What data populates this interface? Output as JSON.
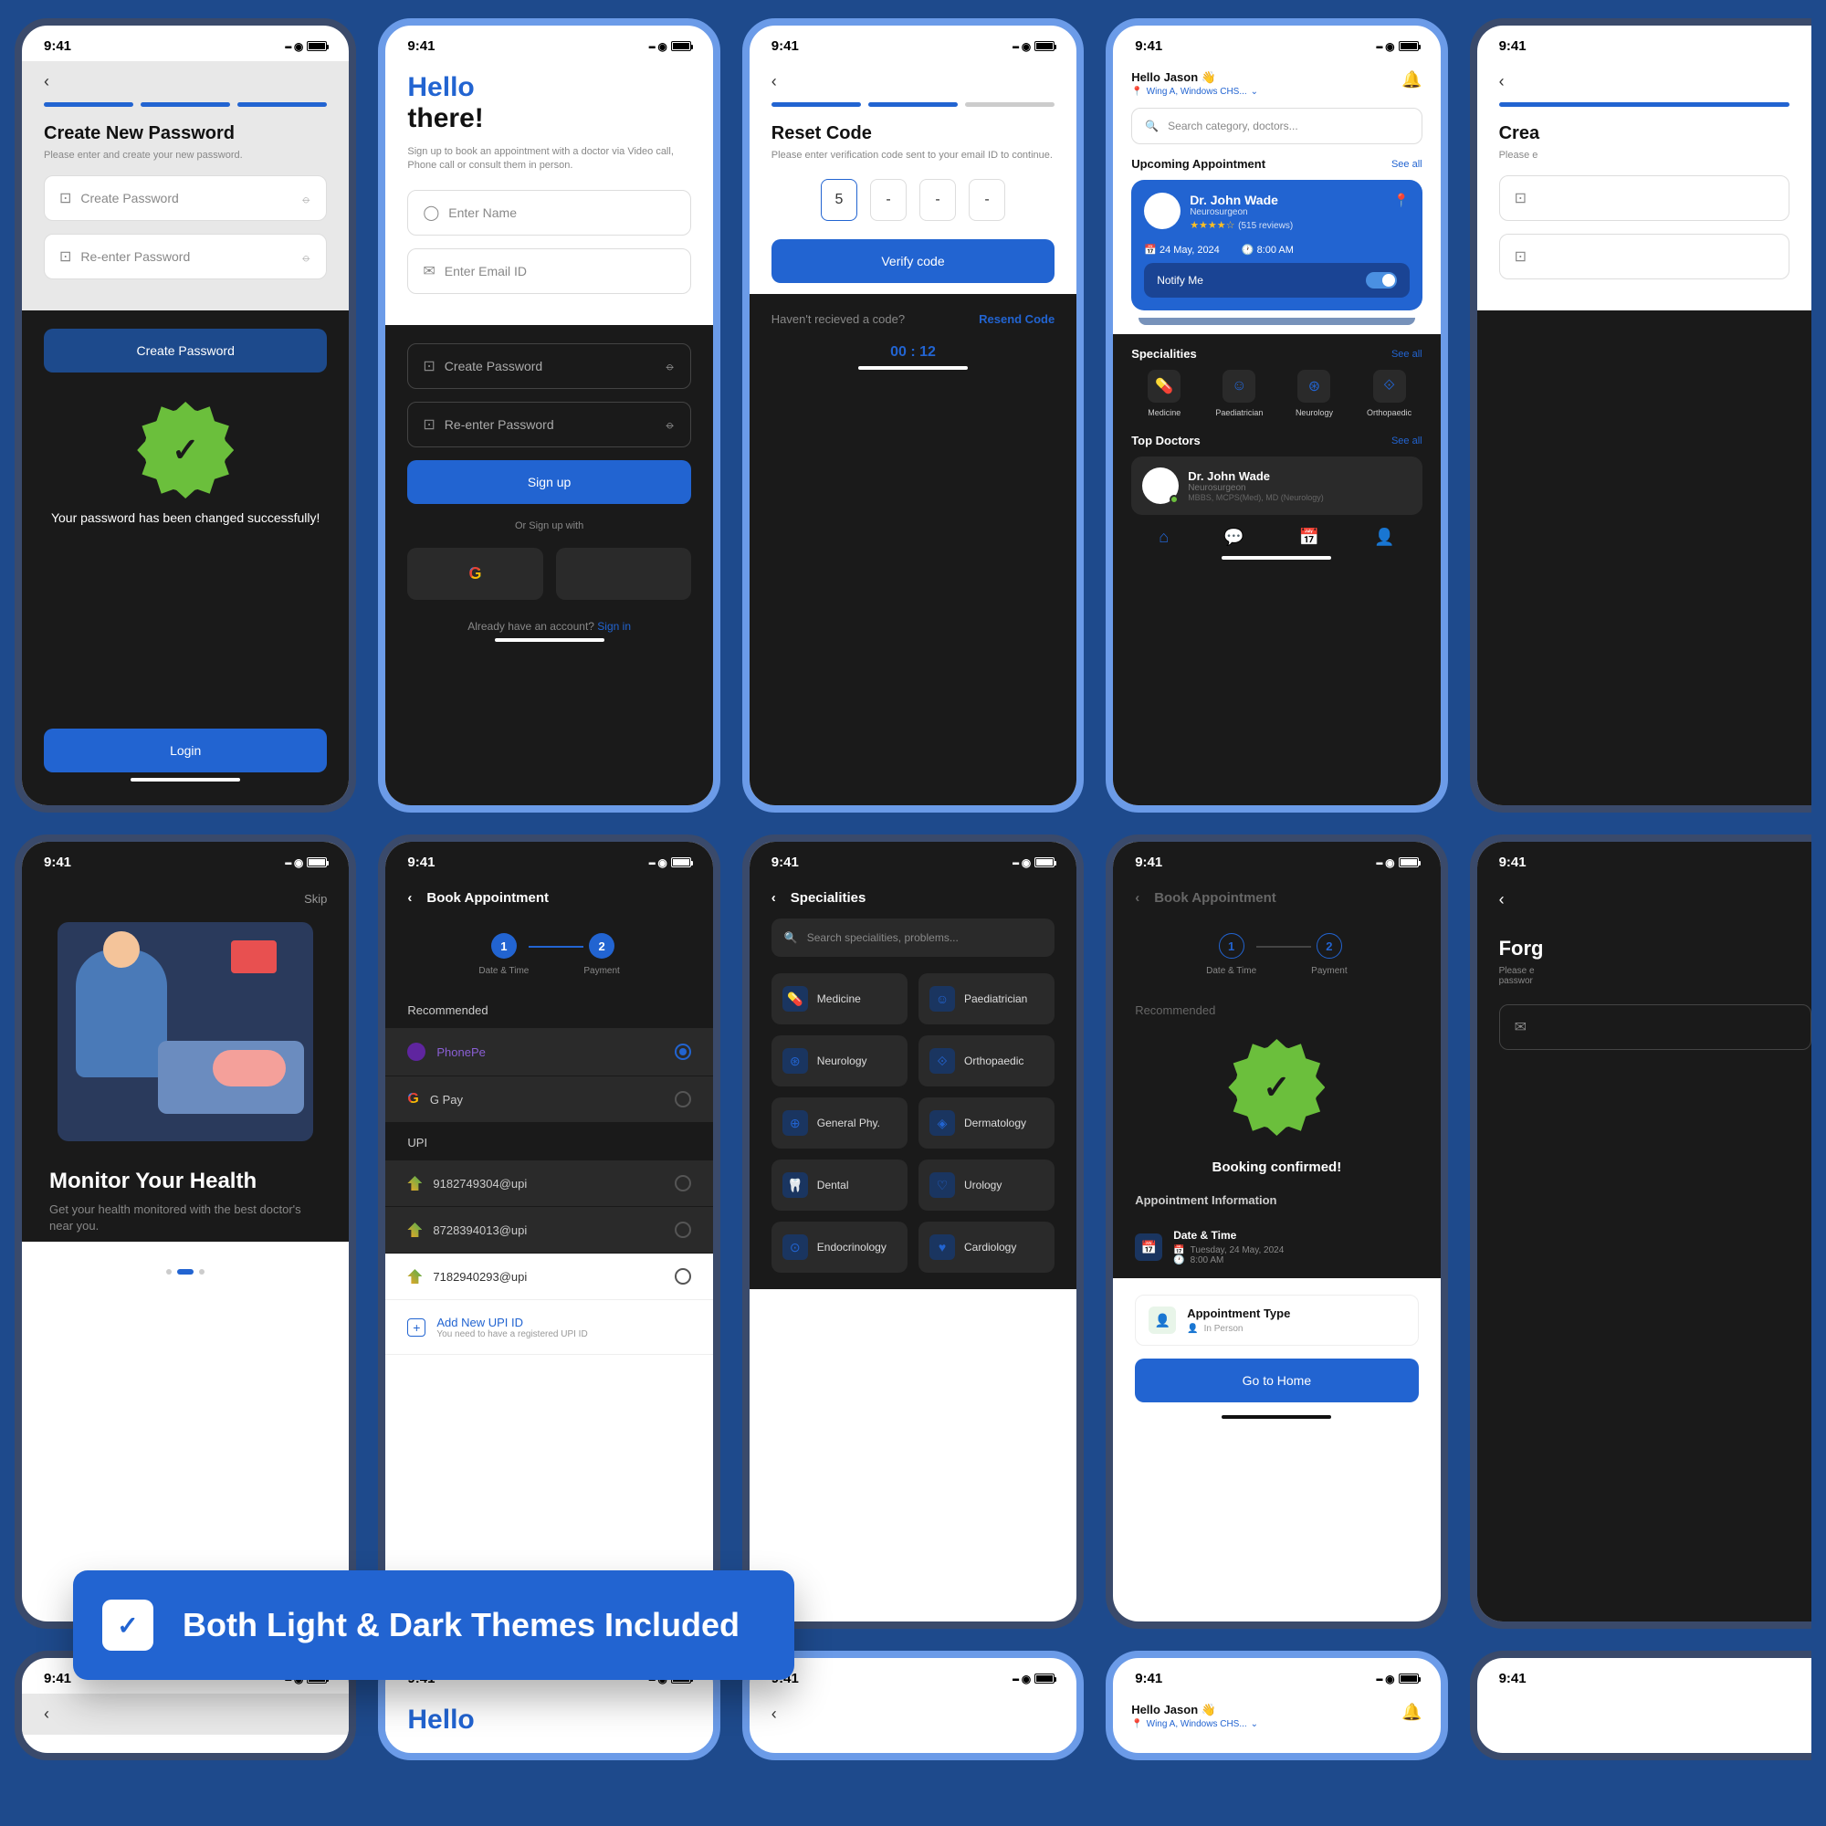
{
  "status_time": "9:41",
  "s1": {
    "title": "Create New Password",
    "subtitle": "Please enter and create your new password.",
    "create_placeholder": "Create Password",
    "reenter_placeholder": "Re-enter Password",
    "btn_create": "Create Password",
    "success_msg": "Your password has been changed successfully!",
    "btn_login": "Login"
  },
  "s2": {
    "hello": "Hello",
    "there": "there!",
    "subtitle": "Sign up to book an appointment with a doctor via Video call, Phone call or consult them in person.",
    "name_placeholder": "Enter Name",
    "email_placeholder": "Enter Email ID",
    "create_placeholder": "Create Password",
    "reenter_placeholder": "Re-enter Password",
    "signup_btn": "Sign up",
    "or_text": "Or Sign up with",
    "have_account": "Already have an account?",
    "signin": "Sign in"
  },
  "s3": {
    "title": "Reset Code",
    "subtitle": "Please enter verification code sent to your email ID to continue.",
    "code_filled": "5",
    "code_empty": "-",
    "verify_btn": "Verify code",
    "no_code": "Haven't recieved a code?",
    "resend": "Resend Code",
    "timer": "00 : 12"
  },
  "s4": {
    "greeting": "Hello Jason 👋",
    "location": "Wing A, Windows CHS...",
    "search_placeholder": "Search category, doctors...",
    "upcoming_title": "Upcoming Appointment",
    "see_all": "See all",
    "doctor_name": "Dr. John Wade",
    "doctor_spec": "Neurosurgeon",
    "reviews": "(515 reviews)",
    "date": "24 May, 2024",
    "time": "8:00 AM",
    "notify": "Notify Me",
    "specialities_title": "Specialities",
    "specs": [
      "Medicine",
      "Paediatrician",
      "Neurology",
      "Orthopaedic"
    ],
    "top_doctors": "Top Doctors",
    "doc_cred": "MBBS, MCPS(Med), MD (Neurology)"
  },
  "s5": {
    "title_partial": "Crea"
  },
  "s6": {
    "skip": "Skip",
    "title": "Monitor Your Health",
    "subtitle": "Get your health monitored with the best doctor's near you."
  },
  "s7": {
    "title": "Book Appointment",
    "step1": "Date & Time",
    "step2": "Payment",
    "recommended": "Recommended",
    "phonepe": "PhonePe",
    "gpay": "G Pay",
    "upi_label": "UPI",
    "upi1": "9182749304@upi",
    "upi2": "8728394013@upi",
    "upi3": "7182940293@upi",
    "add_upi": "Add New UPI ID",
    "add_upi_sub": "You need to have a registered UPI ID"
  },
  "s8": {
    "title": "Specialities",
    "search": "Search specialities, problems...",
    "items": [
      "Medicine",
      "Paediatrician",
      "Neurology",
      "Orthopaedic",
      "General Phy.",
      "Dermatology",
      "Dental",
      "Urology",
      "Endocrinology",
      "Cardiology"
    ]
  },
  "s9": {
    "title": "Book Appointment",
    "step1": "Date & Time",
    "step2": "Payment",
    "recommended": "Recommended",
    "confirmed": "Booking confirmed!",
    "appt_info": "Appointment Information",
    "datetime_label": "Date & Time",
    "date": "Tuesday, 24 May, 2024",
    "time": "8:00 AM",
    "type_label": "Appointment Type",
    "type_value": "In Person",
    "home_btn": "Go to Home"
  },
  "s10": {
    "title_partial": "Forg",
    "sub_partial": "Please e",
    "sub_partial2": "passwor"
  },
  "banner": {
    "text": "Both Light & Dark Themes Included"
  },
  "r3": {
    "greeting": "Hello Jason 👋",
    "location": "Wing A, Windows CHS...",
    "hello": "Hello"
  }
}
